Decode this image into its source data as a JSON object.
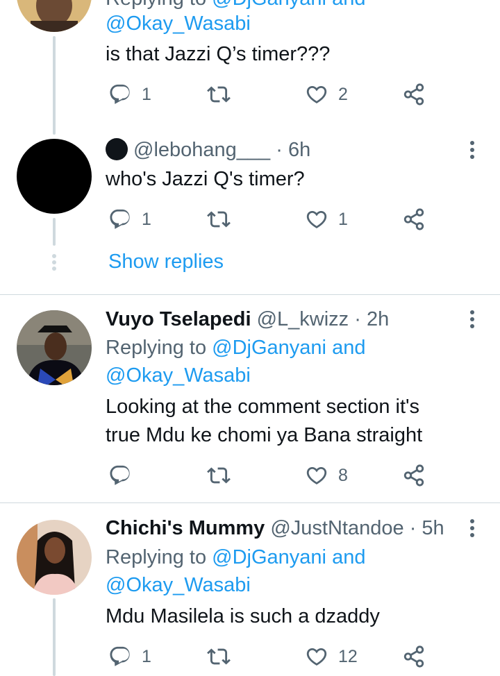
{
  "tweets": [
    {
      "reply_prefix": "Replying to",
      "reply_mention": "@DjGanyani",
      "reply_and": "and",
      "reply_mention2": "@Okay_Wasabi",
      "text": "is that Jazzi Q’s timer???",
      "replies": "1",
      "retweets": "",
      "likes": "2"
    },
    {
      "handle": "@lebohang___",
      "dot": "·",
      "time": "6h",
      "text": "who's Jazzi Q's timer?",
      "replies": "1",
      "retweets": "",
      "likes": "1",
      "show_replies": "Show replies"
    },
    {
      "display_name": "Vuyo Tselapedi",
      "handle": "@L_kwizz",
      "dot": "·",
      "time": "2h",
      "reply_prefix": "Replying to",
      "reply_mention": "@DjGanyani",
      "reply_and": "and",
      "reply_mention2": "@Okay_Wasabi",
      "text_lines": [
        "Looking at the comment section it's",
        "true Mdu ke chomi ya Bana straight"
      ],
      "replies": "",
      "retweets": "",
      "likes": "8"
    },
    {
      "display_name": "Chichi's Mummy",
      "handle": "@JustNtandoe",
      "dot": "·",
      "time": "5h",
      "reply_prefix": "Replying to",
      "reply_mention": "@DjGanyani",
      "reply_and": "and",
      "reply_mention2": "@Okay_Wasabi",
      "text": "Mdu Masilela is such a dzaddy",
      "replies": "1",
      "retweets": "",
      "likes": "12"
    }
  ],
  "icons": {
    "reply": "reply-icon",
    "retweet": "retweet-icon",
    "like": "heart-icon",
    "share": "share-icon",
    "more": "more-vertical-icon"
  },
  "colors": {
    "link": "#1d9bf0",
    "secondary_text": "#536471",
    "thread_line": "#cfd9de"
  }
}
